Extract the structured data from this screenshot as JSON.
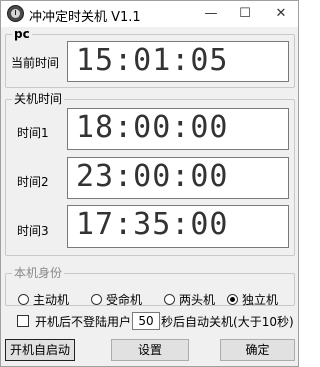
{
  "window": {
    "title": "冲冲定时关机 V1.1"
  },
  "pc_group": {
    "legend": "pc",
    "current_time_label": "当前时间",
    "current_time": "15:01:05"
  },
  "shutdown_group": {
    "legend": "关机时间",
    "times": [
      {
        "label": "时间1",
        "value": "18:00:00"
      },
      {
        "label": "时间2",
        "value": "23:00:00"
      },
      {
        "label": "时间3",
        "value": "17:35:00"
      }
    ]
  },
  "role_group": {
    "legend": "本机身份",
    "options": [
      {
        "label": "主动机",
        "checked": false
      },
      {
        "label": "受命机",
        "checked": false
      },
      {
        "label": "两头机",
        "checked": false
      },
      {
        "label": "独立机",
        "checked": true
      }
    ]
  },
  "auto_shutdown": {
    "prefix": "开机后不登陆用户",
    "seconds": "50",
    "suffix": "秒后自动关机(大于10秒)",
    "checked": false
  },
  "buttons": {
    "autostart": "开机自启动",
    "settings": "设置",
    "ok": "确定"
  }
}
